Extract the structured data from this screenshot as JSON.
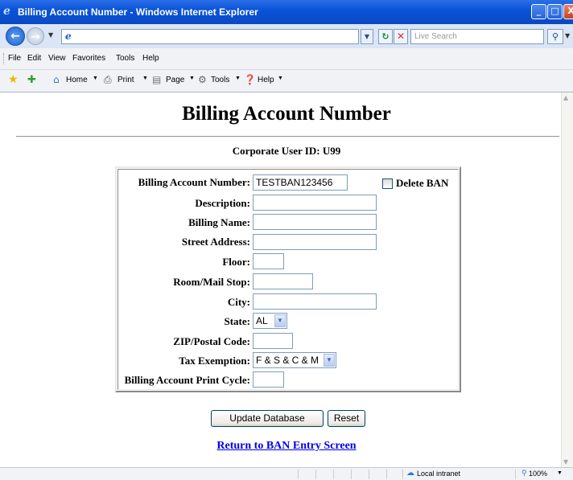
{
  "window": {
    "title": "Billing Account Number - Windows Internet Explorer",
    "min_label": "_",
    "max_label": "□",
    "close_label": "X"
  },
  "address_bar": {
    "url": "",
    "search_placeholder": "Live Search"
  },
  "menu": [
    "File",
    "Edit",
    "View",
    "Favorites",
    "Tools",
    "Help"
  ],
  "command_bar": {
    "home": "Home",
    "print": "Print",
    "page": "Page",
    "tools": "Tools",
    "help": "Help"
  },
  "page": {
    "title": "Billing Account Number",
    "user_id_label": "Corporate User ID: U99",
    "delete_ban_label": "Delete BAN",
    "delete_ban_checked": false,
    "fields": {
      "ban_label": "Billing Account Number:",
      "ban_value": "TESTBAN123456",
      "description_label": "Description:",
      "description_value": "",
      "billing_name_label": "Billing Name:",
      "billing_name_value": "",
      "street_label": "Street Address:",
      "street_value": "",
      "floor_label": "Floor:",
      "floor_value": "",
      "room_label": "Room/Mail Stop:",
      "room_value": "",
      "city_label": "City:",
      "city_value": "",
      "state_label": "State:",
      "state_value": "AL",
      "zip_label": "ZIP/Postal Code:",
      "zip_value": "",
      "tax_label": "Tax Exemption:",
      "tax_value": "F & S & C & M",
      "cycle_label": "Billing Account Print Cycle:",
      "cycle_value": ""
    },
    "update_button": "Update Database",
    "reset_button": "Reset",
    "return_link": "Return to BAN Entry Screen"
  },
  "status_bar": {
    "zone": "Local intranet",
    "zoom": "100%"
  }
}
